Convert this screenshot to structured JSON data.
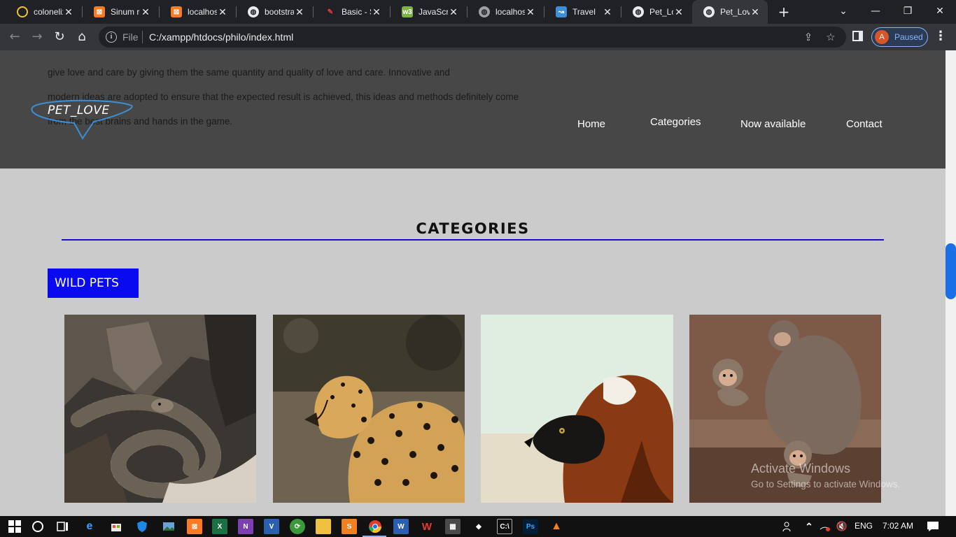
{
  "browser": {
    "tabs": [
      {
        "title": "colonelix",
        "icon": "yellow-circle-icon",
        "color": "#f2c230"
      },
      {
        "title": "Sinum re",
        "icon": "xampp-icon",
        "color": "#fb7a24"
      },
      {
        "title": "localhost",
        "icon": "xampp-icon",
        "color": "#fb7a24"
      },
      {
        "title": "bootstra",
        "icon": "globe-icon",
        "color": "#e8eaed"
      },
      {
        "title": "Basic - S",
        "icon": "codepen-icon",
        "color": "#e0393e"
      },
      {
        "title": "JavaScri",
        "icon": "w3schools-icon",
        "color": "#7cb342"
      },
      {
        "title": "localhost",
        "icon": "globe-icon",
        "color": "#9aa0a6"
      },
      {
        "title": "Travel",
        "icon": "travel-icon",
        "color": "#3c8fd8"
      },
      {
        "title": "Pet_Love",
        "icon": "globe-icon",
        "color": "#e8eaed"
      },
      {
        "title": "Pet_Love",
        "icon": "globe-icon",
        "color": "#e8eaed",
        "active": true
      }
    ],
    "file_label": "File",
    "url": "C:/xampp/htdocs/philo/index.html",
    "profile_initial": "A",
    "profile_status": "Paused"
  },
  "page": {
    "hero_lines": [
      "give love and care by giving them the same quantity and quality of love and care. Innovative and",
      "modern ideas are adopted to ensure that the expected result is achieved, this ideas and methods definitely come",
      "from the best brains and hands in the game."
    ],
    "logo": "PET_LOVE",
    "nav": [
      "Home",
      "Categories",
      "Now available",
      "Contact"
    ],
    "section_title": "CATEGORIES",
    "category_badge": "WILD PETS",
    "cards": [
      {
        "image": "snake",
        "alt": "snake coiled on wood"
      },
      {
        "image": "cheetah",
        "alt": "cheetah looking back"
      },
      {
        "image": "lemur",
        "alt": "red ruffed lemur"
      },
      {
        "image": "monkeys",
        "alt": "monkeys on stone ledge"
      }
    ],
    "colors": {
      "hero_bg": "#474747",
      "page_bg": "#cbcbcb",
      "accent_blue": "#0a0af0"
    }
  },
  "watermark": {
    "line1": "Activate Windows",
    "line2": "Go to Settings to activate Windows."
  },
  "taskbar": {
    "language": "ENG",
    "time": "7:02 AM"
  }
}
